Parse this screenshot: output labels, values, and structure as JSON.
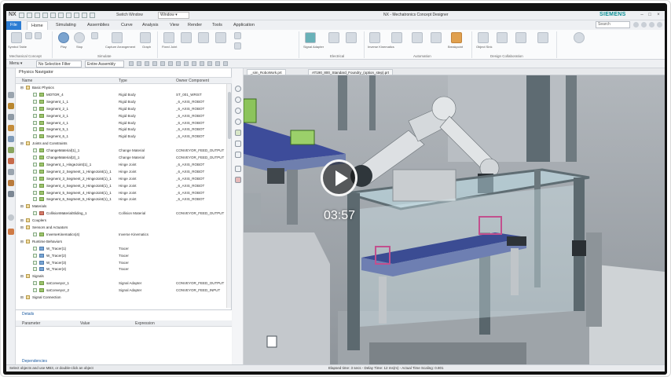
{
  "titlebar": {
    "logo": "NX",
    "switch_window": "Switch Window",
    "window_menu": "Window ▾",
    "app_title": "NX - Mechatronics Concept Designer",
    "brand": "SIEMENS"
  },
  "tabs": [
    "File",
    "Home",
    "Simulating",
    "Assemblies",
    "Curve",
    "Analysis",
    "View",
    "Render",
    "Tools",
    "Application"
  ],
  "search_placeholder": "Search",
  "ribbon": {
    "buttons": [
      "Symbol Table",
      "Play",
      "Stop",
      "Capture Arrangement",
      "Graph",
      "Fixed Joint",
      "Signal Adapter",
      "Inverse Kinematics",
      "Breakpoint",
      "Object Sink"
    ],
    "groups": [
      "Mechanical Concept",
      "Simulate",
      "Electrical",
      "Automation",
      "Design Collaboration"
    ]
  },
  "selection_bar": {
    "menu": "Menu ▾",
    "filter": "No Selection Filter",
    "scope": "Entire Assembly"
  },
  "navigator": {
    "title": "Physics Navigator",
    "columns": [
      "Name",
      "Type",
      "Owner Component"
    ],
    "rows": [
      {
        "name": "Basic Physics",
        "type": "",
        "owner": "",
        "kind": "folder"
      },
      {
        "name": "MOTOR_4",
        "type": "Rigid Body",
        "owner": "ST_001_WRIST",
        "kind": "item"
      },
      {
        "name": "Segment_1_1",
        "type": "Rigid Body",
        "owner": "_6_AXIS_ROBOT",
        "kind": "item"
      },
      {
        "name": "Segment_2_1",
        "type": "Rigid Body",
        "owner": "_6_AXIS_ROBOT",
        "kind": "item"
      },
      {
        "name": "Segment_3_1",
        "type": "Rigid Body",
        "owner": "_6_AXIS_ROBOT",
        "kind": "item"
      },
      {
        "name": "Segment_4_1",
        "type": "Rigid Body",
        "owner": "_6_AXIS_ROBOT",
        "kind": "item"
      },
      {
        "name": "Segment_5_1",
        "type": "Rigid Body",
        "owner": "_6_AXIS_ROBOT",
        "kind": "item"
      },
      {
        "name": "Segment_6_1",
        "type": "Rigid Body",
        "owner": "_6_AXIS_ROBOT",
        "kind": "item"
      },
      {
        "name": "Joints and Constraints",
        "type": "",
        "owner": "",
        "kind": "folder"
      },
      {
        "name": "ChangeMaterial(1)_1",
        "type": "Change Material",
        "owner": "CONVEYOR_FEED_OUTPUT",
        "kind": "item"
      },
      {
        "name": "ChangeMaterial(2)_1",
        "type": "Change Material",
        "owner": "CONVEYOR_FEED_OUTPUT",
        "kind": "item"
      },
      {
        "name": "Segment_1_HingeJoint(1)_1",
        "type": "Hinge Joint",
        "owner": "_6_AXIS_ROBOT",
        "kind": "item"
      },
      {
        "name": "Segment_2_Segment_1_HingeJoint(1)_1",
        "type": "Hinge Joint",
        "owner": "_6_AXIS_ROBOT",
        "kind": "item"
      },
      {
        "name": "Segment_3_Segment_2_HingeJoint(1)_1",
        "type": "Hinge Joint",
        "owner": "_6_AXIS_ROBOT",
        "kind": "item"
      },
      {
        "name": "Segment_4_Segment_3_HingeJoint(1)_1",
        "type": "Hinge Joint",
        "owner": "_6_AXIS_ROBOT",
        "kind": "item"
      },
      {
        "name": "Segment_5_Segment_4_HingeJoint(1)_1",
        "type": "Hinge Joint",
        "owner": "_6_AXIS_ROBOT",
        "kind": "item"
      },
      {
        "name": "Segment_6_Segment_5_HingeJoint(1)_1",
        "type": "Hinge Joint",
        "owner": "_6_AXIS_ROBOT",
        "kind": "item"
      },
      {
        "name": "Materials",
        "type": "",
        "owner": "",
        "kind": "folder"
      },
      {
        "name": "CollisionMaterialSliding_1",
        "type": "Collision Material",
        "owner": "CONVEYOR_FEED_OUTPUT",
        "kind": "item"
      },
      {
        "name": "Couplers",
        "type": "",
        "owner": "",
        "kind": "folder"
      },
      {
        "name": "Sensors and Actuators",
        "type": "",
        "owner": "",
        "kind": "folder"
      },
      {
        "name": "InverseKinematics(4)",
        "type": "Inverse Kinematics",
        "owner": "",
        "kind": "item"
      },
      {
        "name": "Runtime Behaviors",
        "type": "",
        "owner": "",
        "kind": "folder"
      },
      {
        "name": "W_Tracer(1)",
        "type": "Tracer",
        "owner": "",
        "kind": "item"
      },
      {
        "name": "W_Tracer(2)",
        "type": "Tracer",
        "owner": "",
        "kind": "item"
      },
      {
        "name": "W_Tracer(3)",
        "type": "Tracer",
        "owner": "",
        "kind": "item"
      },
      {
        "name": "W_Tracer(4)",
        "type": "Tracer",
        "owner": "",
        "kind": "item"
      },
      {
        "name": "Signals",
        "type": "",
        "owner": "",
        "kind": "folder"
      },
      {
        "name": "saConveyor_1",
        "type": "Signal Adapter",
        "owner": "CONVEYOR_FEED_OUTPUT",
        "kind": "item"
      },
      {
        "name": "saConveyor_2",
        "type": "Signal Adapter",
        "owner": "CONVEYOR_FEED_INPUT",
        "kind": "item"
      },
      {
        "name": "Signal Connection",
        "type": "",
        "owner": "",
        "kind": "folder"
      }
    ]
  },
  "details": {
    "title": "Details",
    "columns": [
      "Parameter",
      "Value",
      "Expression"
    ],
    "dependencies": "Dependencies"
  },
  "viewport_tabs": [
    "_sim_RoboWork.prt",
    "AT190_800_Standard_Foundry_(option_step).prt"
  ],
  "status": {
    "left": "Select objects and use MB3, or double-click an object",
    "right": "Elapsed time: 3 secs - Delay Time: 12 ms(m) - Actual Time Scaling: 0.801"
  },
  "video": {
    "duration": "03:57"
  },
  "colors": {
    "accent": "#2b7cd3",
    "brand": "#0a8f95"
  }
}
